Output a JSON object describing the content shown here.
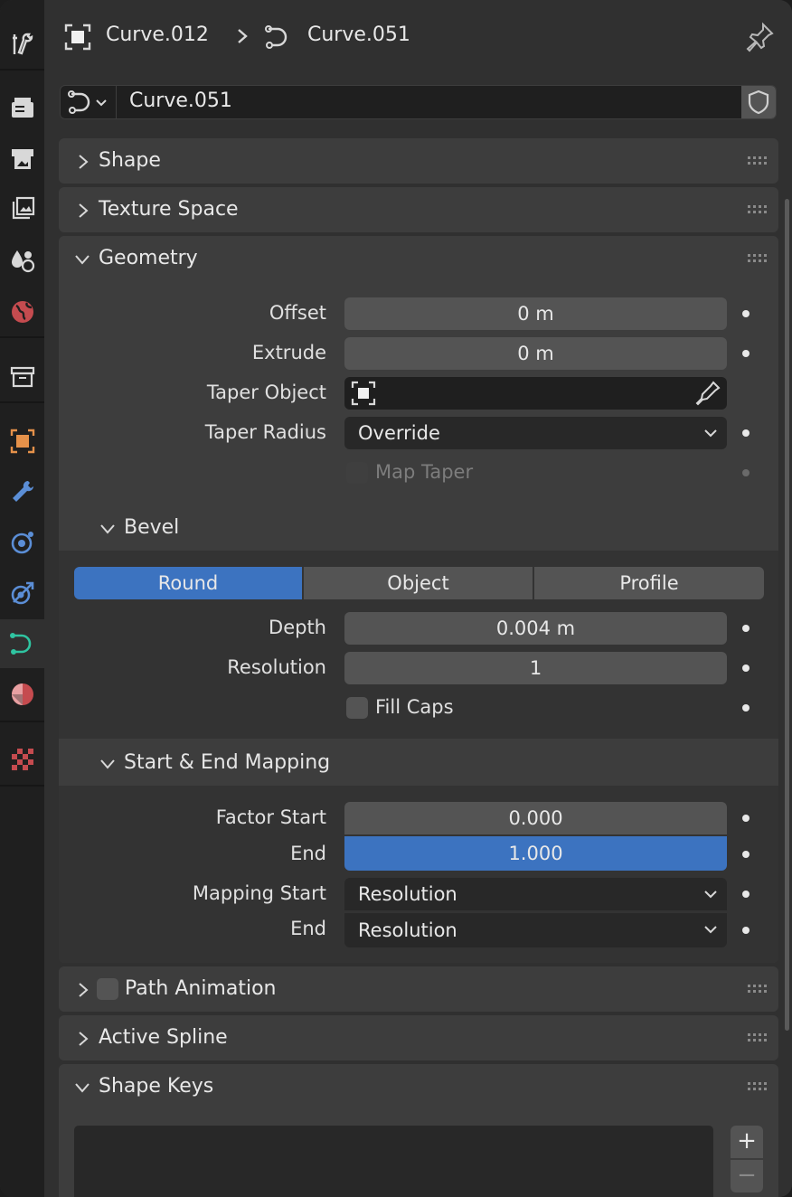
{
  "breadcrumb": {
    "object": "Curve.012",
    "data": "Curve.051"
  },
  "datablock": {
    "name": "Curve.051"
  },
  "panels": {
    "shape": "Shape",
    "texture_space": "Texture Space",
    "geometry": "Geometry",
    "path_animation": "Path Animation",
    "active_spline": "Active Spline",
    "shape_keys": "Shape Keys"
  },
  "geometry": {
    "offset_label": "Offset",
    "offset_value": "0 m",
    "extrude_label": "Extrude",
    "extrude_value": "0 m",
    "taper_object_label": "Taper Object",
    "taper_radius_label": "Taper Radius",
    "taper_radius_value": "Override",
    "map_taper_label": "Map Taper"
  },
  "bevel": {
    "title": "Bevel",
    "modes": [
      "Round",
      "Object",
      "Profile"
    ],
    "active_mode": "Round",
    "depth_label": "Depth",
    "depth_value": "0.004 m",
    "resolution_label": "Resolution",
    "resolution_value": "1",
    "fill_caps_label": "Fill Caps"
  },
  "mapping": {
    "title": "Start & End Mapping",
    "factor_start_label": "Factor Start",
    "factor_start_value": "0.000",
    "factor_end_label": "End",
    "factor_end_value": "1.000",
    "mapping_start_label": "Mapping Start",
    "mapping_start_value": "Resolution",
    "mapping_end_label": "End",
    "mapping_end_value": "Resolution"
  },
  "shape_keys": {
    "add": "+",
    "remove": "−"
  },
  "colors": {
    "accent": "#3c73c0",
    "curve_tab": "#2fc4a1",
    "object_tab": "#e5914a",
    "wrench": "#5b8ed6"
  },
  "tab_icons": [
    "tool-icon",
    "render-icon",
    "output-icon",
    "view-layer-icon",
    "scene-icon",
    "world-icon",
    "collection-icon",
    "object-icon",
    "modifier-icon",
    "particles-icon",
    "physics-icon",
    "curve-data-icon",
    "material-icon",
    "texture-icon"
  ]
}
